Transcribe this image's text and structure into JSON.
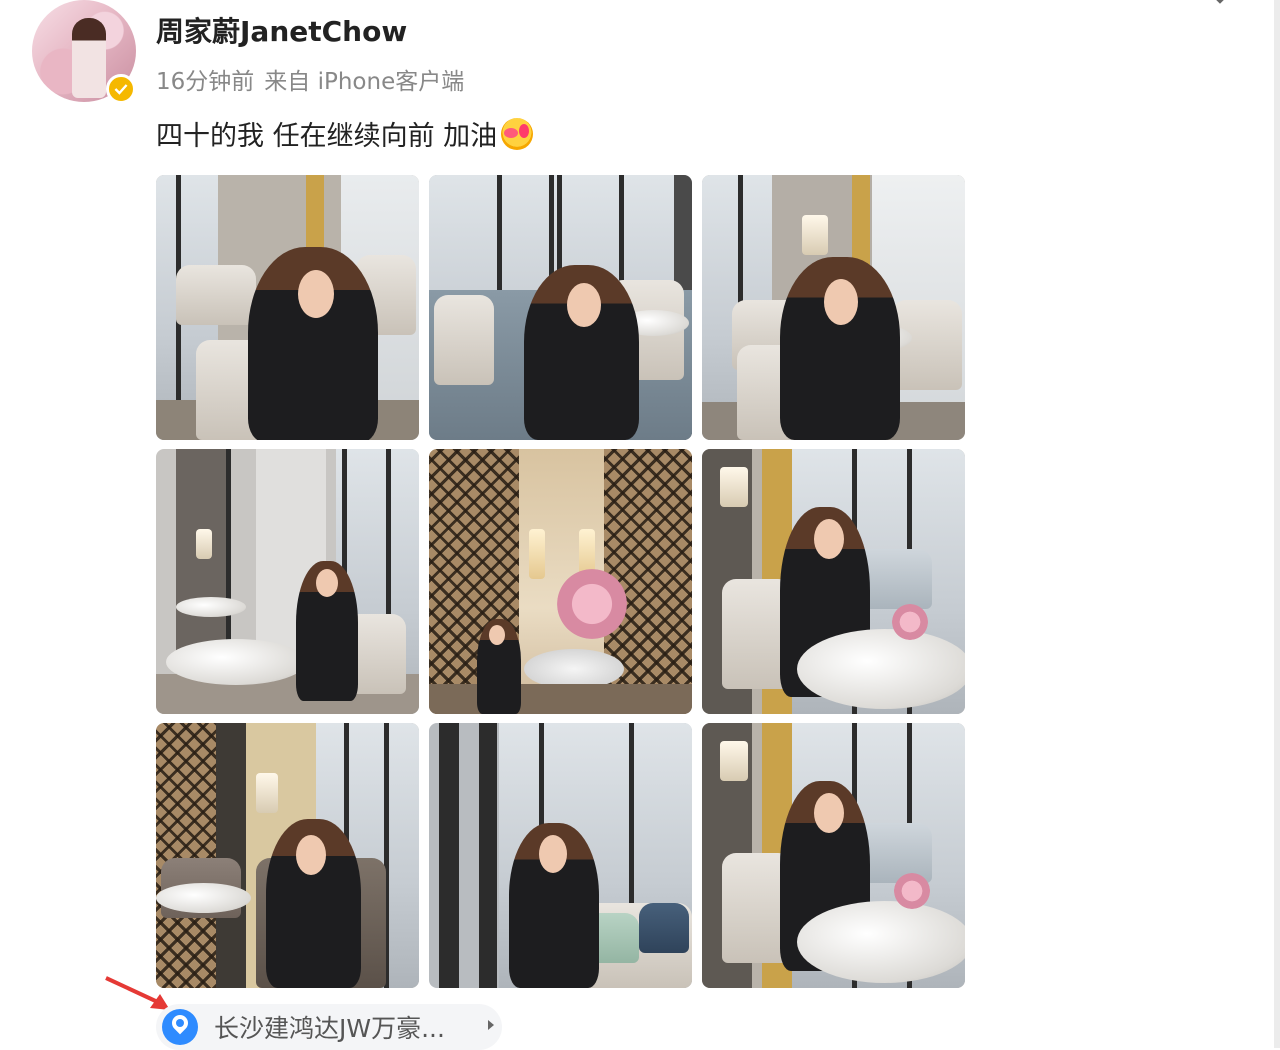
{
  "post": {
    "username": "周家蔚JanetChow",
    "time": "16分钟前",
    "source": "来自 iPhone客户端",
    "text": "四十的我 任在继续向前 加油",
    "emoji": "face-blowing-kiss-icon",
    "verified": true,
    "image_count": 9
  },
  "location": {
    "label": "长沙建鸿达JW万豪...",
    "icon": "location-pin-icon"
  },
  "colors": {
    "username": "#222222",
    "meta": "#888888",
    "location_pill": "#f4f5f7",
    "pin": "#2e8bff",
    "verified_badge": "#f5b800",
    "annotation_arrow": "#e53935"
  }
}
